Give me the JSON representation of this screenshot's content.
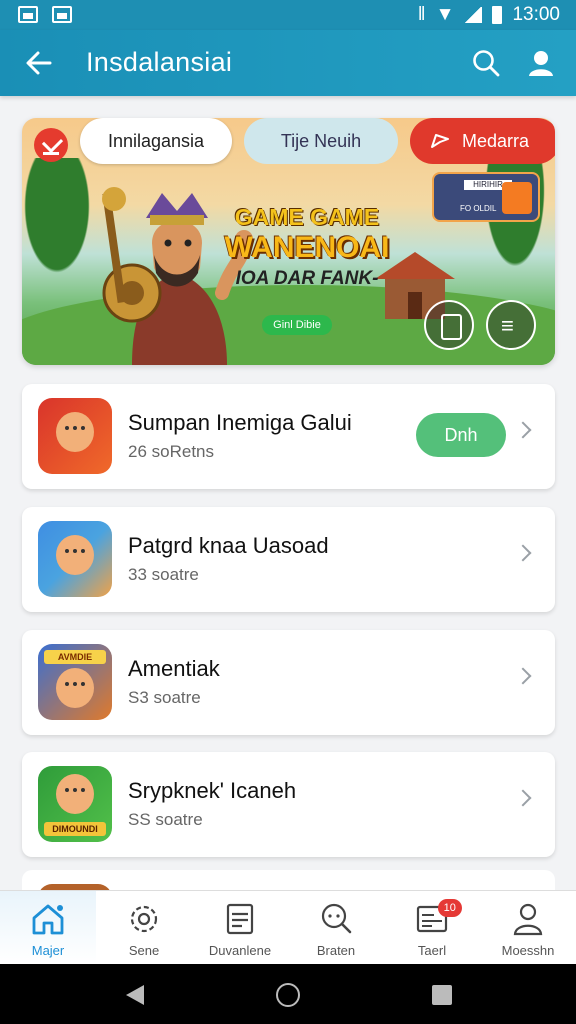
{
  "statusbar": {
    "time": "13:00"
  },
  "appbar": {
    "title": "Insdalansiai"
  },
  "banner": {
    "tabs": [
      "Innilagansia",
      "Tije Neuih",
      "Medarra"
    ],
    "promo_line1": "GAME GAME",
    "promo_line2": "WANENOAI",
    "promo_line3": "IOA DAR FANK-",
    "promo_badge": "Ginl Dibie",
    "mini_card_text": "HIRIHIR",
    "mini_card_sub": "FO OLDIL"
  },
  "list": [
    {
      "name": "Sumpan Inemiga Galui",
      "meta": "26 soRetns",
      "action": "Dnh"
    },
    {
      "name": "Patgrd knaa Uasoad",
      "meta": "33 soatre"
    },
    {
      "name": "Amentiak",
      "meta": "S3 soatre",
      "icon_tag": "AVMDIE"
    },
    {
      "name": "Srypknek' Icaneh",
      "meta": "SS soatre",
      "icon_tag": "DIMOUNDI"
    }
  ],
  "bottomnav": [
    {
      "label": "Majer",
      "icon": "home-icon",
      "active": true
    },
    {
      "label": "Sene",
      "icon": "gear-icon"
    },
    {
      "label": "Duvanlene",
      "icon": "list-icon"
    },
    {
      "label": "Braten",
      "icon": "search-chat-icon"
    },
    {
      "label": "Taerl",
      "icon": "inbox-icon",
      "badge": "10"
    },
    {
      "label": "Moesshn",
      "icon": "profile-icon"
    }
  ]
}
